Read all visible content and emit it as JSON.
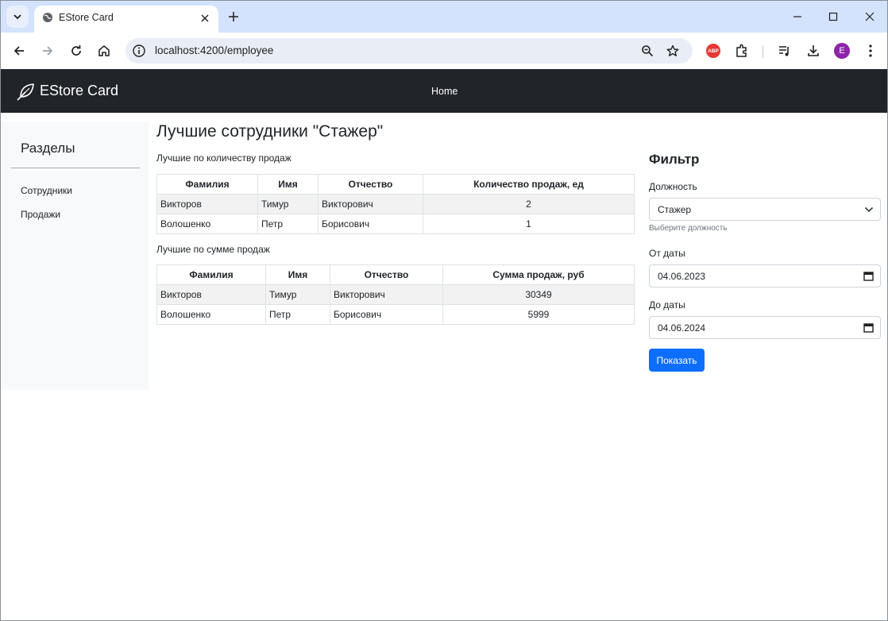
{
  "browser": {
    "tab_title": "EStore Card",
    "url": "localhost:4200/employee",
    "abp_label": "ABP",
    "profile_initial": "E"
  },
  "navbar": {
    "brand": "EStore Card",
    "home_link": "Home"
  },
  "sidebar": {
    "title": "Разделы",
    "items": [
      {
        "label": "Сотрудники"
      },
      {
        "label": "Продажи"
      }
    ]
  },
  "main": {
    "title": "Лучшие сотрудники \"Стажер\"",
    "by_count": {
      "title": "Лучшие по количеству продаж",
      "headers": [
        "Фамилия",
        "Имя",
        "Отчество",
        "Количество продаж, ед"
      ],
      "rows": [
        [
          "Викторов",
          "Тимур",
          "Викторович",
          "2"
        ],
        [
          "Волошенко",
          "Петр",
          "Борисович",
          "1"
        ]
      ]
    },
    "by_sum": {
      "title": "Лучшие по сумме продаж",
      "headers": [
        "Фамилия",
        "Имя",
        "Отчество",
        "Сумма продаж, руб"
      ],
      "rows": [
        [
          "Викторов",
          "Тимур",
          "Викторович",
          "30349"
        ],
        [
          "Волошенко",
          "Петр",
          "Борисович",
          "5999"
        ]
      ]
    }
  },
  "filter": {
    "title": "Фильтр",
    "position_label": "Должность",
    "position_value": "Стажер",
    "position_help": "Выберите должность",
    "from_label": "От даты",
    "from_value": "04.06.2023",
    "to_label": "До даты",
    "to_value": "04.06.2024",
    "submit_label": "Показать"
  },
  "colors": {
    "navbar_bg": "#212529",
    "primary": "#0d6efd",
    "tabstrip": "#d3e3fd"
  }
}
